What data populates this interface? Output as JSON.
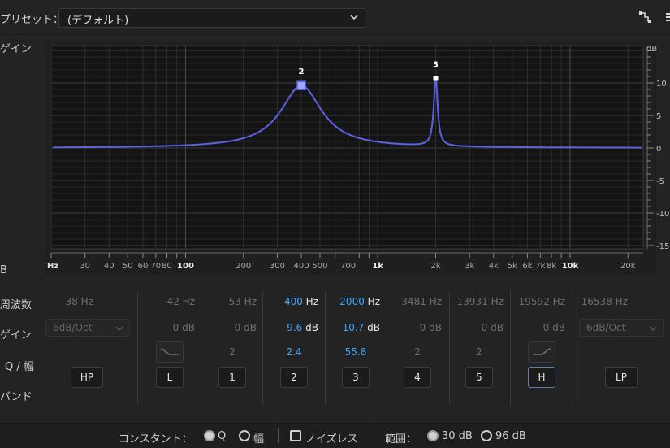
{
  "preset": {
    "label": "プリセット：",
    "value": "(デフォルト)"
  },
  "side_labels": {
    "gain_axis": "ゲイン",
    "db_axis": "B",
    "frequency": "周波数",
    "gain": "ゲイン",
    "q_width": "Q / 幅",
    "band": "バンド"
  },
  "graph": {
    "db_unit": "dB",
    "hz_unit": "Hz",
    "y_ticks": [
      "10",
      "5",
      "0",
      "-5",
      "-10",
      "-15"
    ],
    "x_ticks": [
      "30",
      "40",
      "50",
      "60",
      "70",
      "80",
      "100",
      "200",
      "300",
      "400",
      "500",
      "700",
      "1k",
      "2k",
      "3k",
      "4k",
      "5k",
      "6k",
      "7k",
      "8k",
      "10k",
      "20k"
    ],
    "markers": [
      {
        "label": "2",
        "freq": 400,
        "gain": 9.6
      },
      {
        "label": "3",
        "freq": 2000,
        "gain": 10.7
      }
    ],
    "curve_color": "#5b63e0"
  },
  "bands": [
    {
      "id": "HP",
      "freq": "38",
      "freq_unit": "Hz",
      "slope": "6dB/Oct",
      "button": "HP",
      "active": false
    },
    {
      "id": "L",
      "freq": "42",
      "freq_unit": "Hz",
      "gain": "0",
      "gain_unit": "dB",
      "button": "L",
      "shape_icon": "low-shelf-icon",
      "active": false
    },
    {
      "id": "1",
      "freq": "53",
      "freq_unit": "Hz",
      "gain": "0",
      "gain_unit": "dB",
      "q": "2",
      "button": "1",
      "active": false
    },
    {
      "id": "2",
      "freq": "400",
      "freq_unit": "Hz",
      "gain": "9.6",
      "gain_unit": "dB",
      "q": "2.4",
      "button": "2",
      "active": true
    },
    {
      "id": "3",
      "freq": "2000",
      "freq_unit": "Hz",
      "gain": "10.7",
      "gain_unit": "dB",
      "q": "55.8",
      "button": "3",
      "active": true
    },
    {
      "id": "4",
      "freq": "3481",
      "freq_unit": "Hz",
      "gain": "0",
      "gain_unit": "dB",
      "q": "2",
      "button": "4",
      "active": false
    },
    {
      "id": "5",
      "freq": "13931",
      "freq_unit": "Hz",
      "gain": "0",
      "gain_unit": "dB",
      "q": "2",
      "button": "5",
      "active": false
    },
    {
      "id": "H",
      "freq": "19592",
      "freq_unit": "Hz",
      "gain": "0",
      "gain_unit": "dB",
      "button": "H",
      "shape_icon": "high-shelf-icon",
      "active": false,
      "selected": true
    },
    {
      "id": "LP",
      "freq": "16538",
      "freq_unit": "Hz",
      "slope": "6dB/Oct",
      "button": "LP",
      "active": false
    }
  ],
  "bottom": {
    "constant_label": "コンスタント：",
    "q_label": "Q",
    "width_label": "幅",
    "noiseless_label": "ノイズレス",
    "range_label": "範囲：",
    "range_30": "30 dB",
    "range_96": "96 dB"
  },
  "colors": {
    "accent": "#3ea6ff",
    "curve": "#5b63e0",
    "background": "#232323"
  }
}
